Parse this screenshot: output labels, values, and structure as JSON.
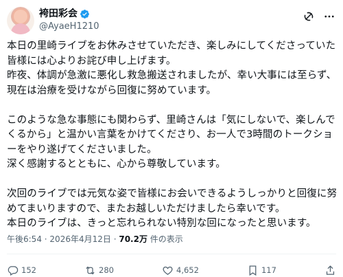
{
  "author": {
    "display_name": "袴田彩会",
    "handle": "@AyaeH1210",
    "verified_color": "#1d9bf0"
  },
  "tweet": {
    "paragraphs": [
      "本日の里崎ライブをお休みさせていただき、楽しみにしてくださっていた皆様には心よりお詫び申し上げます。",
      "昨夜、体調が急激に悪化し救急搬送されましたが、幸い大事には至らず、現在は治療を受けながら回復に努めています。",
      "",
      "このような急な事態にも関わらず、里崎さんは「気にしないで、楽しんでくるから」と温かい言葉をかけてくださり、お一人で3時間のトークショーをやり遂げてくださいました。",
      "深く感謝するとともに、心から尊敬しています。",
      "",
      "次回のライブでは元気な姿で皆様にお会いできるようしっかりと回復に努めてまいりますので、またお越しいただけましたら幸いです。",
      "本日のライブは、きっと忘れられない特別な回になったと思います。"
    ],
    "time": "午後6:54",
    "date": "2026年4月12日",
    "views": "70.2万",
    "views_label": "件の表示"
  },
  "actions": {
    "replies": "152",
    "retweets": "280",
    "likes": "4,652",
    "bookmarks": "117"
  },
  "icons": [
    "verified-badge-icon",
    "grok-icon",
    "more-icon",
    "reply-icon",
    "retweet-icon",
    "like-icon",
    "bookmark-icon",
    "share-icon"
  ]
}
